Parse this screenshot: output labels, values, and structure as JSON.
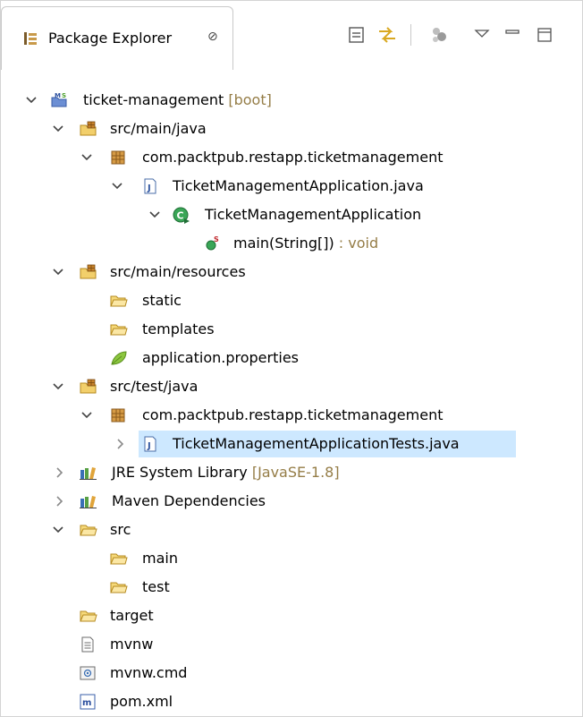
{
  "view": {
    "title": "Package Explorer",
    "close_glyph": "⊘"
  },
  "toolbar": {
    "buttons": [
      "collapse-all-icon",
      "link-with-editor-icon",
      "focus-on-active-task-icon",
      "view-menu-icon",
      "minimize-icon",
      "maximize-icon"
    ]
  },
  "tree": {
    "items": [
      {
        "label": "ticket-management",
        "decoration": " [boot]",
        "icon": "maven-spring-project-icon",
        "expanded": true
      },
      {
        "label": "src/main/java",
        "icon": "source-folder-icon",
        "expanded": true
      },
      {
        "label": "com.packtpub.restapp.ticketmanagement",
        "icon": "package-icon",
        "expanded": true
      },
      {
        "label": "TicketManagementApplication.java",
        "icon": "java-file-icon",
        "expanded": true
      },
      {
        "label": "TicketManagementApplication",
        "icon": "class-icon",
        "expanded": true
      },
      {
        "label": "main(String[])",
        "decoration": " : void",
        "icon": "static-method-icon"
      },
      {
        "label": "src/main/resources",
        "icon": "source-folder-icon",
        "expanded": true
      },
      {
        "label": "static",
        "icon": "folder-icon"
      },
      {
        "label": "templates",
        "icon": "folder-icon"
      },
      {
        "label": "application.properties",
        "icon": "spring-properties-icon"
      },
      {
        "label": "src/test/java",
        "icon": "source-folder-icon",
        "expanded": true
      },
      {
        "label": "com.packtpub.restapp.ticketmanagement",
        "icon": "package-icon",
        "expanded": true
      },
      {
        "label": "TicketManagementApplicationTests.java",
        "icon": "java-file-icon",
        "expanded": false,
        "selected": true
      },
      {
        "label": "JRE System Library",
        "decoration": " [JavaSE-1.8]",
        "icon": "library-icon",
        "expanded": false
      },
      {
        "label": "Maven Dependencies",
        "icon": "library-icon",
        "expanded": false
      },
      {
        "label": "src",
        "icon": "folder-icon",
        "expanded": true
      },
      {
        "label": "main",
        "icon": "folder-icon"
      },
      {
        "label": "test",
        "icon": "folder-icon"
      },
      {
        "label": "target",
        "icon": "folder-icon"
      },
      {
        "label": "mvnw",
        "icon": "text-file-icon"
      },
      {
        "label": "mvnw.cmd",
        "icon": "cmd-file-icon"
      },
      {
        "label": "pom.xml",
        "icon": "maven-pom-icon"
      }
    ]
  }
}
